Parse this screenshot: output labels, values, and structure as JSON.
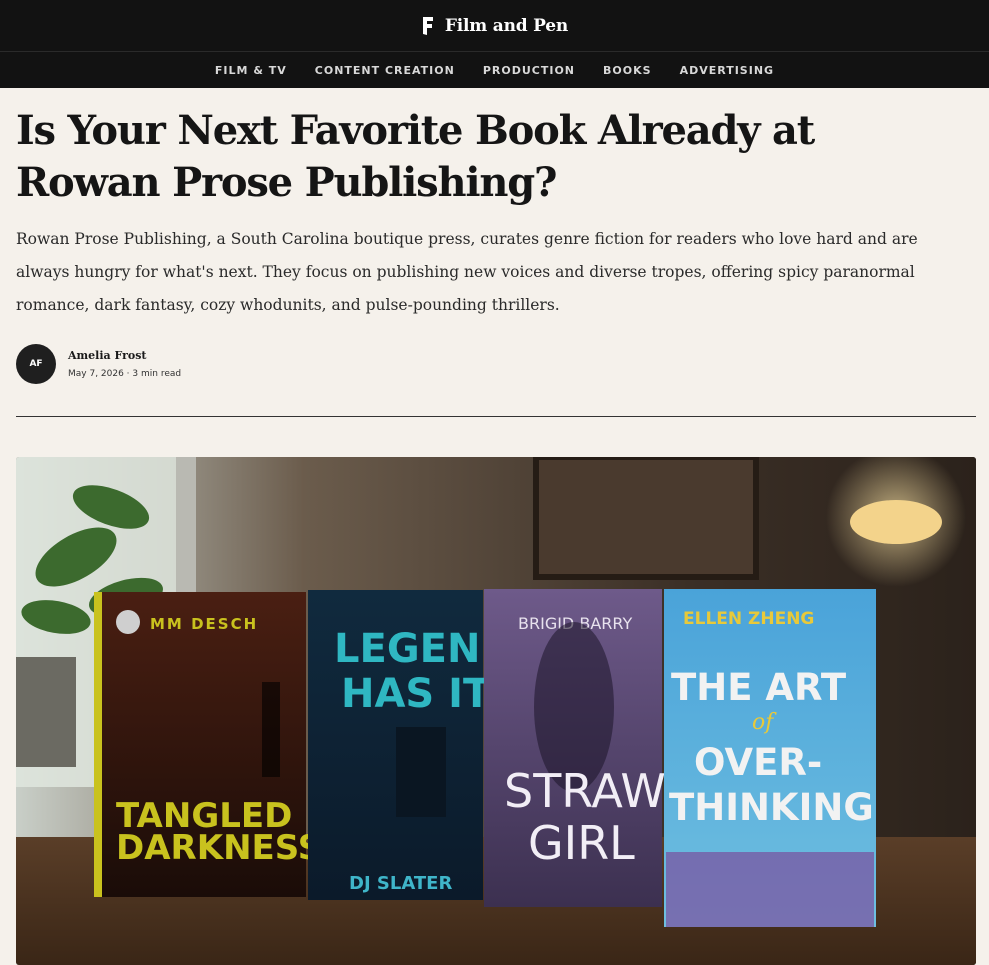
{
  "site": {
    "brand_name": "Film and Pen",
    "logo_icon": "f-logo-icon"
  },
  "nav": {
    "items": [
      {
        "label": "FILM & TV"
      },
      {
        "label": "CONTENT CREATION"
      },
      {
        "label": "PRODUCTION"
      },
      {
        "label": "BOOKS"
      },
      {
        "label": "ADVERTISING"
      }
    ]
  },
  "article": {
    "title": "Is Your Next Favorite Book Already at Rowan Prose Publishing?",
    "dek": "Rowan Prose Publishing, a South Carolina boutique press, curates genre fiction for readers who love hard and are always hungry for what's next. They focus on publishing new voices and diverse tropes, offering spicy paranormal romance, dark fantasy, cozy whodunits, and pulse-pounding thrillers.",
    "author": {
      "initials": "AF",
      "name": "Amelia Frost"
    },
    "meta": "May 7, 2026 · 3 min read"
  },
  "hero": {
    "books": [
      {
        "author": "MM DESCH",
        "title_line1": "TANGLED",
        "title_line2": "DARKNESS"
      },
      {
        "author": "DJ SLATER",
        "title_line1": "LEGEND",
        "title_line2": "HAS IT"
      },
      {
        "author": "BRIGID BARRY",
        "title_line1": "STRAW",
        "title_line2": "GIRL"
      },
      {
        "author": "ELLEN ZHENG",
        "title_line1": "THE ART",
        "title_line2": "of",
        "title_line3": "OVER-",
        "title_line4": "THINKING"
      }
    ]
  },
  "colors": {
    "topbar": "#121212",
    "page_bg": "#f5f1eb",
    "accent_yellow": "#c9c21e",
    "teal": "#3fb5c9",
    "sky_blue": "#4aa3d9"
  }
}
